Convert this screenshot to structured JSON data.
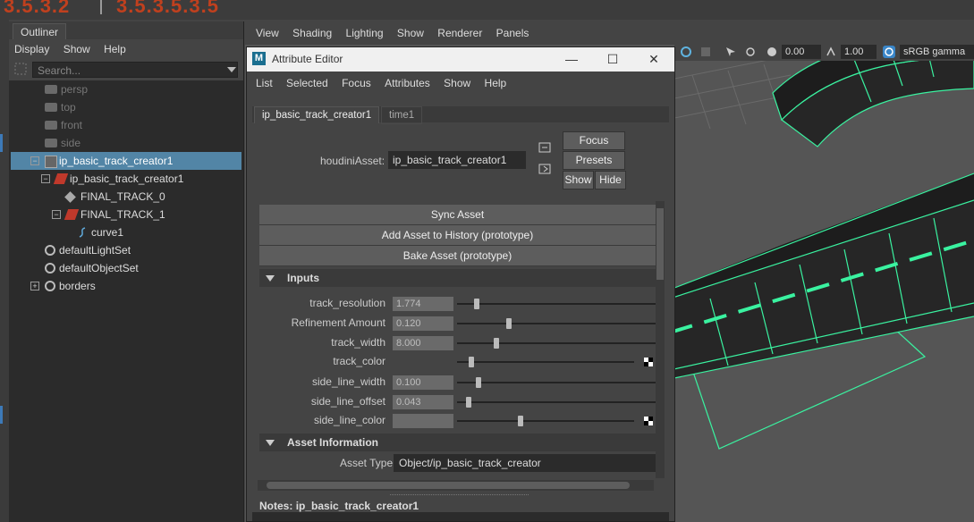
{
  "colors": {
    "selection": "#5285a6",
    "track_green": "#3af2a0",
    "title_bg": "#f0f0f0"
  },
  "topbar": {
    "left_ghost": "3.5.3.2",
    "right_ghost": "3.5.3.5.3.5"
  },
  "outliner": {
    "tab": "Outliner",
    "menu": [
      "Display",
      "Show",
      "Help"
    ],
    "search_placeholder": "Search...",
    "items": [
      {
        "label": "persp",
        "icon": "camera-icon"
      },
      {
        "label": "top",
        "icon": "camera-icon"
      },
      {
        "label": "front",
        "icon": "camera-icon"
      },
      {
        "label": "side",
        "icon": "camera-icon"
      },
      {
        "label": "ip_basic_track_creator1",
        "icon": "asset-icon"
      },
      {
        "label": "ip_basic_track_creator1",
        "icon": "asset-shape-icon"
      },
      {
        "label": "FINAL_TRACK_0",
        "icon": "mesh-icon"
      },
      {
        "label": "FINAL_TRACK_1",
        "icon": "asset-shape-icon"
      },
      {
        "label": "curve1",
        "icon": "curve-icon"
      },
      {
        "label": "defaultLightSet",
        "icon": "set-icon"
      },
      {
        "label": "defaultObjectSet",
        "icon": "set-icon"
      },
      {
        "label": "borders",
        "icon": "set-icon"
      }
    ]
  },
  "viewport": {
    "menu": [
      "View",
      "Shading",
      "Lighting",
      "Show",
      "Renderer",
      "Panels"
    ],
    "exposure": "0.00",
    "gamma": "1.00",
    "color_space": "sRGB gamma"
  },
  "attribute_editor": {
    "title": "Attribute Editor",
    "menu": [
      "List",
      "Selected",
      "Focus",
      "Attributes",
      "Show",
      "Help"
    ],
    "tabs": [
      "ip_basic_track_creator1",
      "time1"
    ],
    "houdini_asset_label": "houdiniAsset:",
    "houdini_asset_value": "ip_basic_track_creator1",
    "focus_btn": "Focus",
    "presets_btn": "Presets",
    "show_btn": "Show",
    "hide_btn": "Hide",
    "sync_btn": "Sync Asset",
    "history_btn": "Add Asset to History (prototype)",
    "bake_btn": "Bake Asset (prototype)",
    "inputs_section": "Inputs",
    "attrs": [
      {
        "label": "track_resolution",
        "value": "1.774",
        "slider": 0.1
      },
      {
        "label": "Refinement Amount",
        "value": "0.120",
        "slider": 0.26
      },
      {
        "label": "track_width",
        "value": "8.000",
        "slider": 0.2
      },
      {
        "label": "track_color",
        "value": "",
        "slider": 0.08
      },
      {
        "label": "side_line_width",
        "value": "0.100",
        "slider": 0.11
      },
      {
        "label": "side_line_offset",
        "value": "0.043",
        "slider": 0.06
      },
      {
        "label": "side_line_color",
        "value": "",
        "slider": 0.36
      }
    ],
    "asset_info_section": "Asset Information",
    "asset_type_label": "Asset Type",
    "asset_type_value": "Object/ip_basic_track_creator",
    "notes_label": "Notes:",
    "notes_value": "ip_basic_track_creator1"
  }
}
